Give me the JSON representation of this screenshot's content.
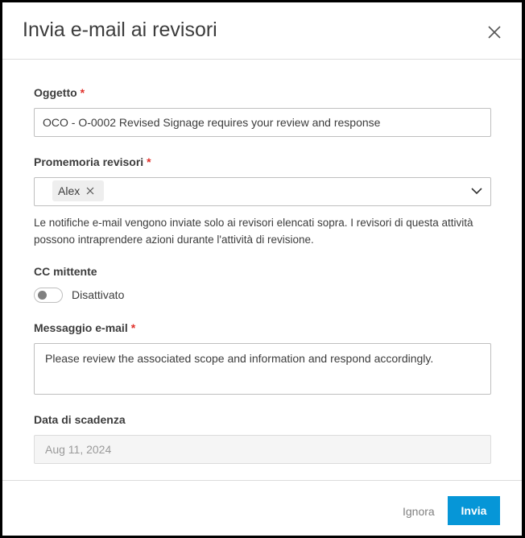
{
  "dialog": {
    "title": "Invia e-mail ai revisori",
    "close_icon": "close-icon"
  },
  "subject": {
    "label": "Oggetto",
    "required": "*",
    "value": "OCO - O-0002 Revised Signage requires your review and response"
  },
  "reviewers": {
    "label": "Promemoria revisori",
    "required": "*",
    "chips": [
      "Alex"
    ],
    "help": "Le notifiche e-mail vengono inviate solo ai revisori elencati sopra. I revisori di questa attività possono intraprendere azioni durante l'attività di revisione."
  },
  "cc": {
    "label": "CC mittente",
    "state": "Disattivato",
    "on": false
  },
  "message": {
    "label": "Messaggio e-mail",
    "required": "*",
    "value": "Please review the associated scope and information and respond accordingly."
  },
  "due": {
    "label": "Data di scadenza",
    "value": "Aug 11, 2024"
  },
  "footer": {
    "cancel": "Ignora",
    "send": "Invia"
  },
  "colors": {
    "accent": "#0696d7",
    "required": "#e0302a"
  }
}
